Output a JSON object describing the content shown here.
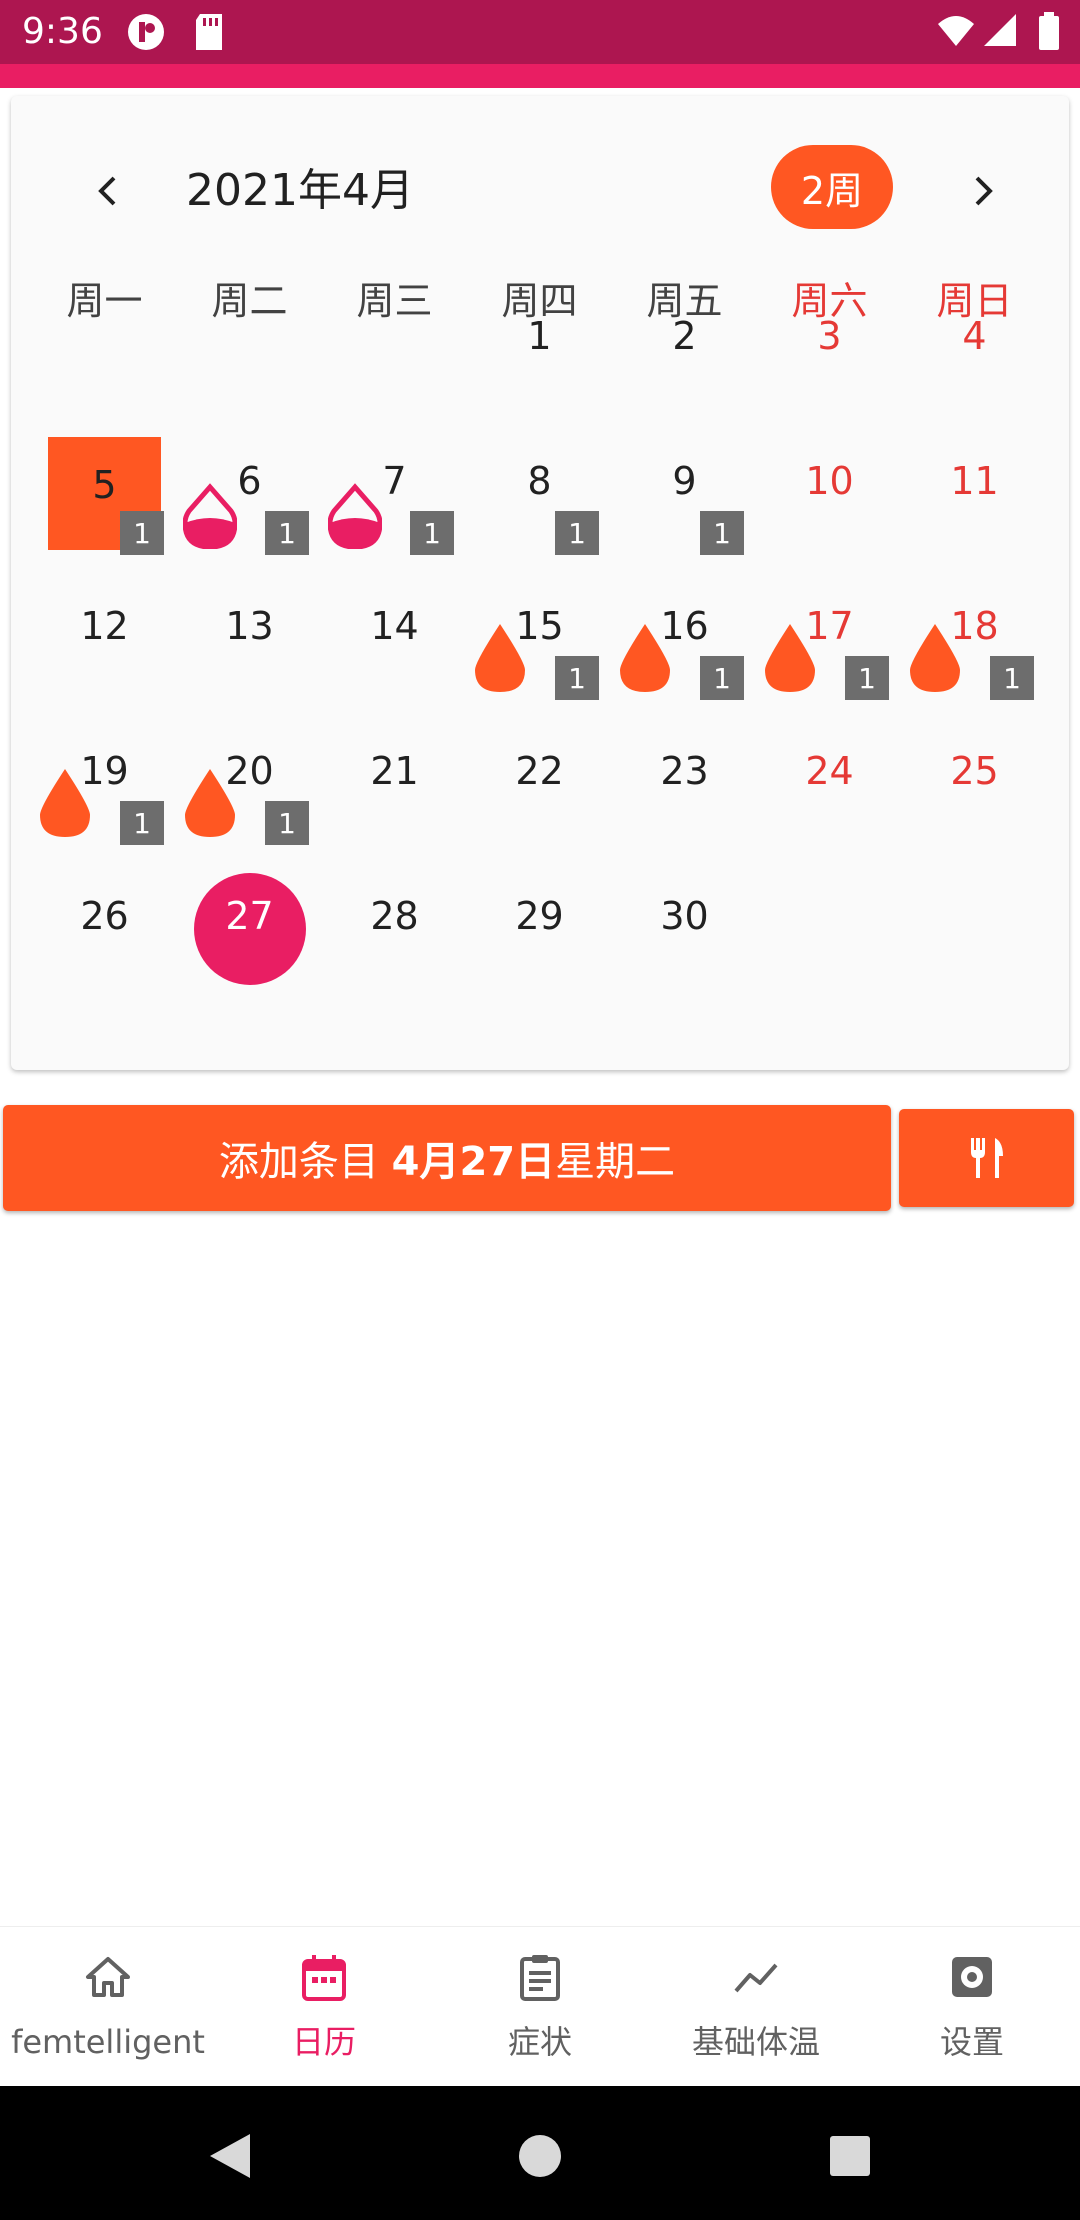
{
  "status_bar": {
    "time": "9:36"
  },
  "calendar": {
    "month_title": "2021年4月",
    "week_pill": "2周",
    "weekdays": [
      "周一",
      "周二",
      "周三",
      "周四",
      "周五",
      "周六",
      "周日"
    ],
    "days": [
      {
        "day": "1",
        "col": 3,
        "row": 0
      },
      {
        "day": "2",
        "col": 4,
        "row": 0
      },
      {
        "day": "3",
        "col": 5,
        "row": 0
      },
      {
        "day": "4",
        "col": 6,
        "row": 0
      },
      {
        "day": "5",
        "col": 0,
        "row": 1,
        "highlight": "today-square",
        "badge": "1"
      },
      {
        "day": "6",
        "col": 1,
        "row": 1,
        "drop": "outline",
        "badge": "1"
      },
      {
        "day": "7",
        "col": 2,
        "row": 1,
        "drop": "outline",
        "badge": "1"
      },
      {
        "day": "8",
        "col": 3,
        "row": 1,
        "badge": "1"
      },
      {
        "day": "9",
        "col": 4,
        "row": 1,
        "badge": "1"
      },
      {
        "day": "10",
        "col": 5,
        "row": 1
      },
      {
        "day": "11",
        "col": 6,
        "row": 1
      },
      {
        "day": "12",
        "col": 0,
        "row": 2
      },
      {
        "day": "13",
        "col": 1,
        "row": 2
      },
      {
        "day": "14",
        "col": 2,
        "row": 2
      },
      {
        "day": "15",
        "col": 3,
        "row": 2,
        "drop": "solid",
        "badge": "1"
      },
      {
        "day": "16",
        "col": 4,
        "row": 2,
        "drop": "solid",
        "badge": "1"
      },
      {
        "day": "17",
        "col": 5,
        "row": 2,
        "drop": "solid",
        "badge": "1"
      },
      {
        "day": "18",
        "col": 6,
        "row": 2,
        "drop": "solid",
        "badge": "1"
      },
      {
        "day": "19",
        "col": 0,
        "row": 3,
        "drop": "solid",
        "badge": "1"
      },
      {
        "day": "20",
        "col": 1,
        "row": 3,
        "drop": "solid",
        "badge": "1"
      },
      {
        "day": "21",
        "col": 2,
        "row": 3
      },
      {
        "day": "22",
        "col": 3,
        "row": 3
      },
      {
        "day": "23",
        "col": 4,
        "row": 3
      },
      {
        "day": "24",
        "col": 5,
        "row": 3
      },
      {
        "day": "25",
        "col": 6,
        "row": 3
      },
      {
        "day": "26",
        "col": 0,
        "row": 4
      },
      {
        "day": "27",
        "col": 1,
        "row": 4,
        "highlight": "selected-circle"
      },
      {
        "day": "28",
        "col": 2,
        "row": 4
      },
      {
        "day": "29",
        "col": 3,
        "row": 4
      },
      {
        "day": "30",
        "col": 4,
        "row": 4
      }
    ]
  },
  "actions": {
    "add_entry_prefix": "添加条目 ",
    "add_entry_date": "4月27日",
    "add_entry_suffix": "星期二",
    "meal_icon": "fork-knife-icon"
  },
  "bottom_nav": [
    {
      "label": "femtelligent",
      "icon": "home-icon",
      "active": false
    },
    {
      "label": "日历",
      "icon": "calendar-icon",
      "active": true
    },
    {
      "label": "症状",
      "icon": "clipboard-icon",
      "active": false
    },
    {
      "label": "基础体温",
      "icon": "trend-line-icon",
      "active": false
    },
    {
      "label": "设置",
      "icon": "settings-icon",
      "active": false
    }
  ],
  "colors": {
    "status_bar": "#AD1650",
    "accent": "#FF5722",
    "pink": "#E91E63",
    "weekend": "#E53935"
  }
}
